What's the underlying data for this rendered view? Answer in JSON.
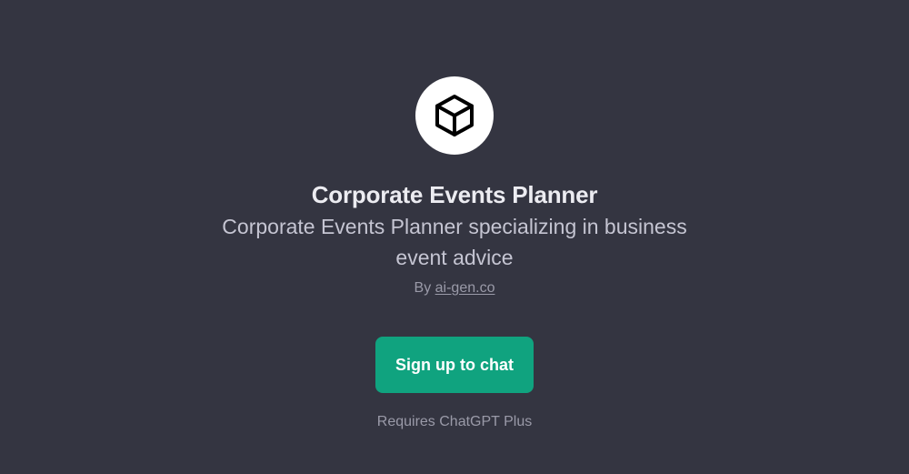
{
  "gpt": {
    "title": "Corporate Events Planner",
    "description": "Corporate Events Planner specializing in business event advice",
    "by_prefix": "By",
    "author": "ai-gen.co",
    "avatar_icon": "cube-icon"
  },
  "actions": {
    "signup_label": "Sign up to chat"
  },
  "footer": {
    "requirement": "Requires ChatGPT Plus"
  },
  "colors": {
    "background": "#343541",
    "accent": "#10a37f",
    "title": "#ececf1",
    "muted": "#9a9aa8"
  }
}
